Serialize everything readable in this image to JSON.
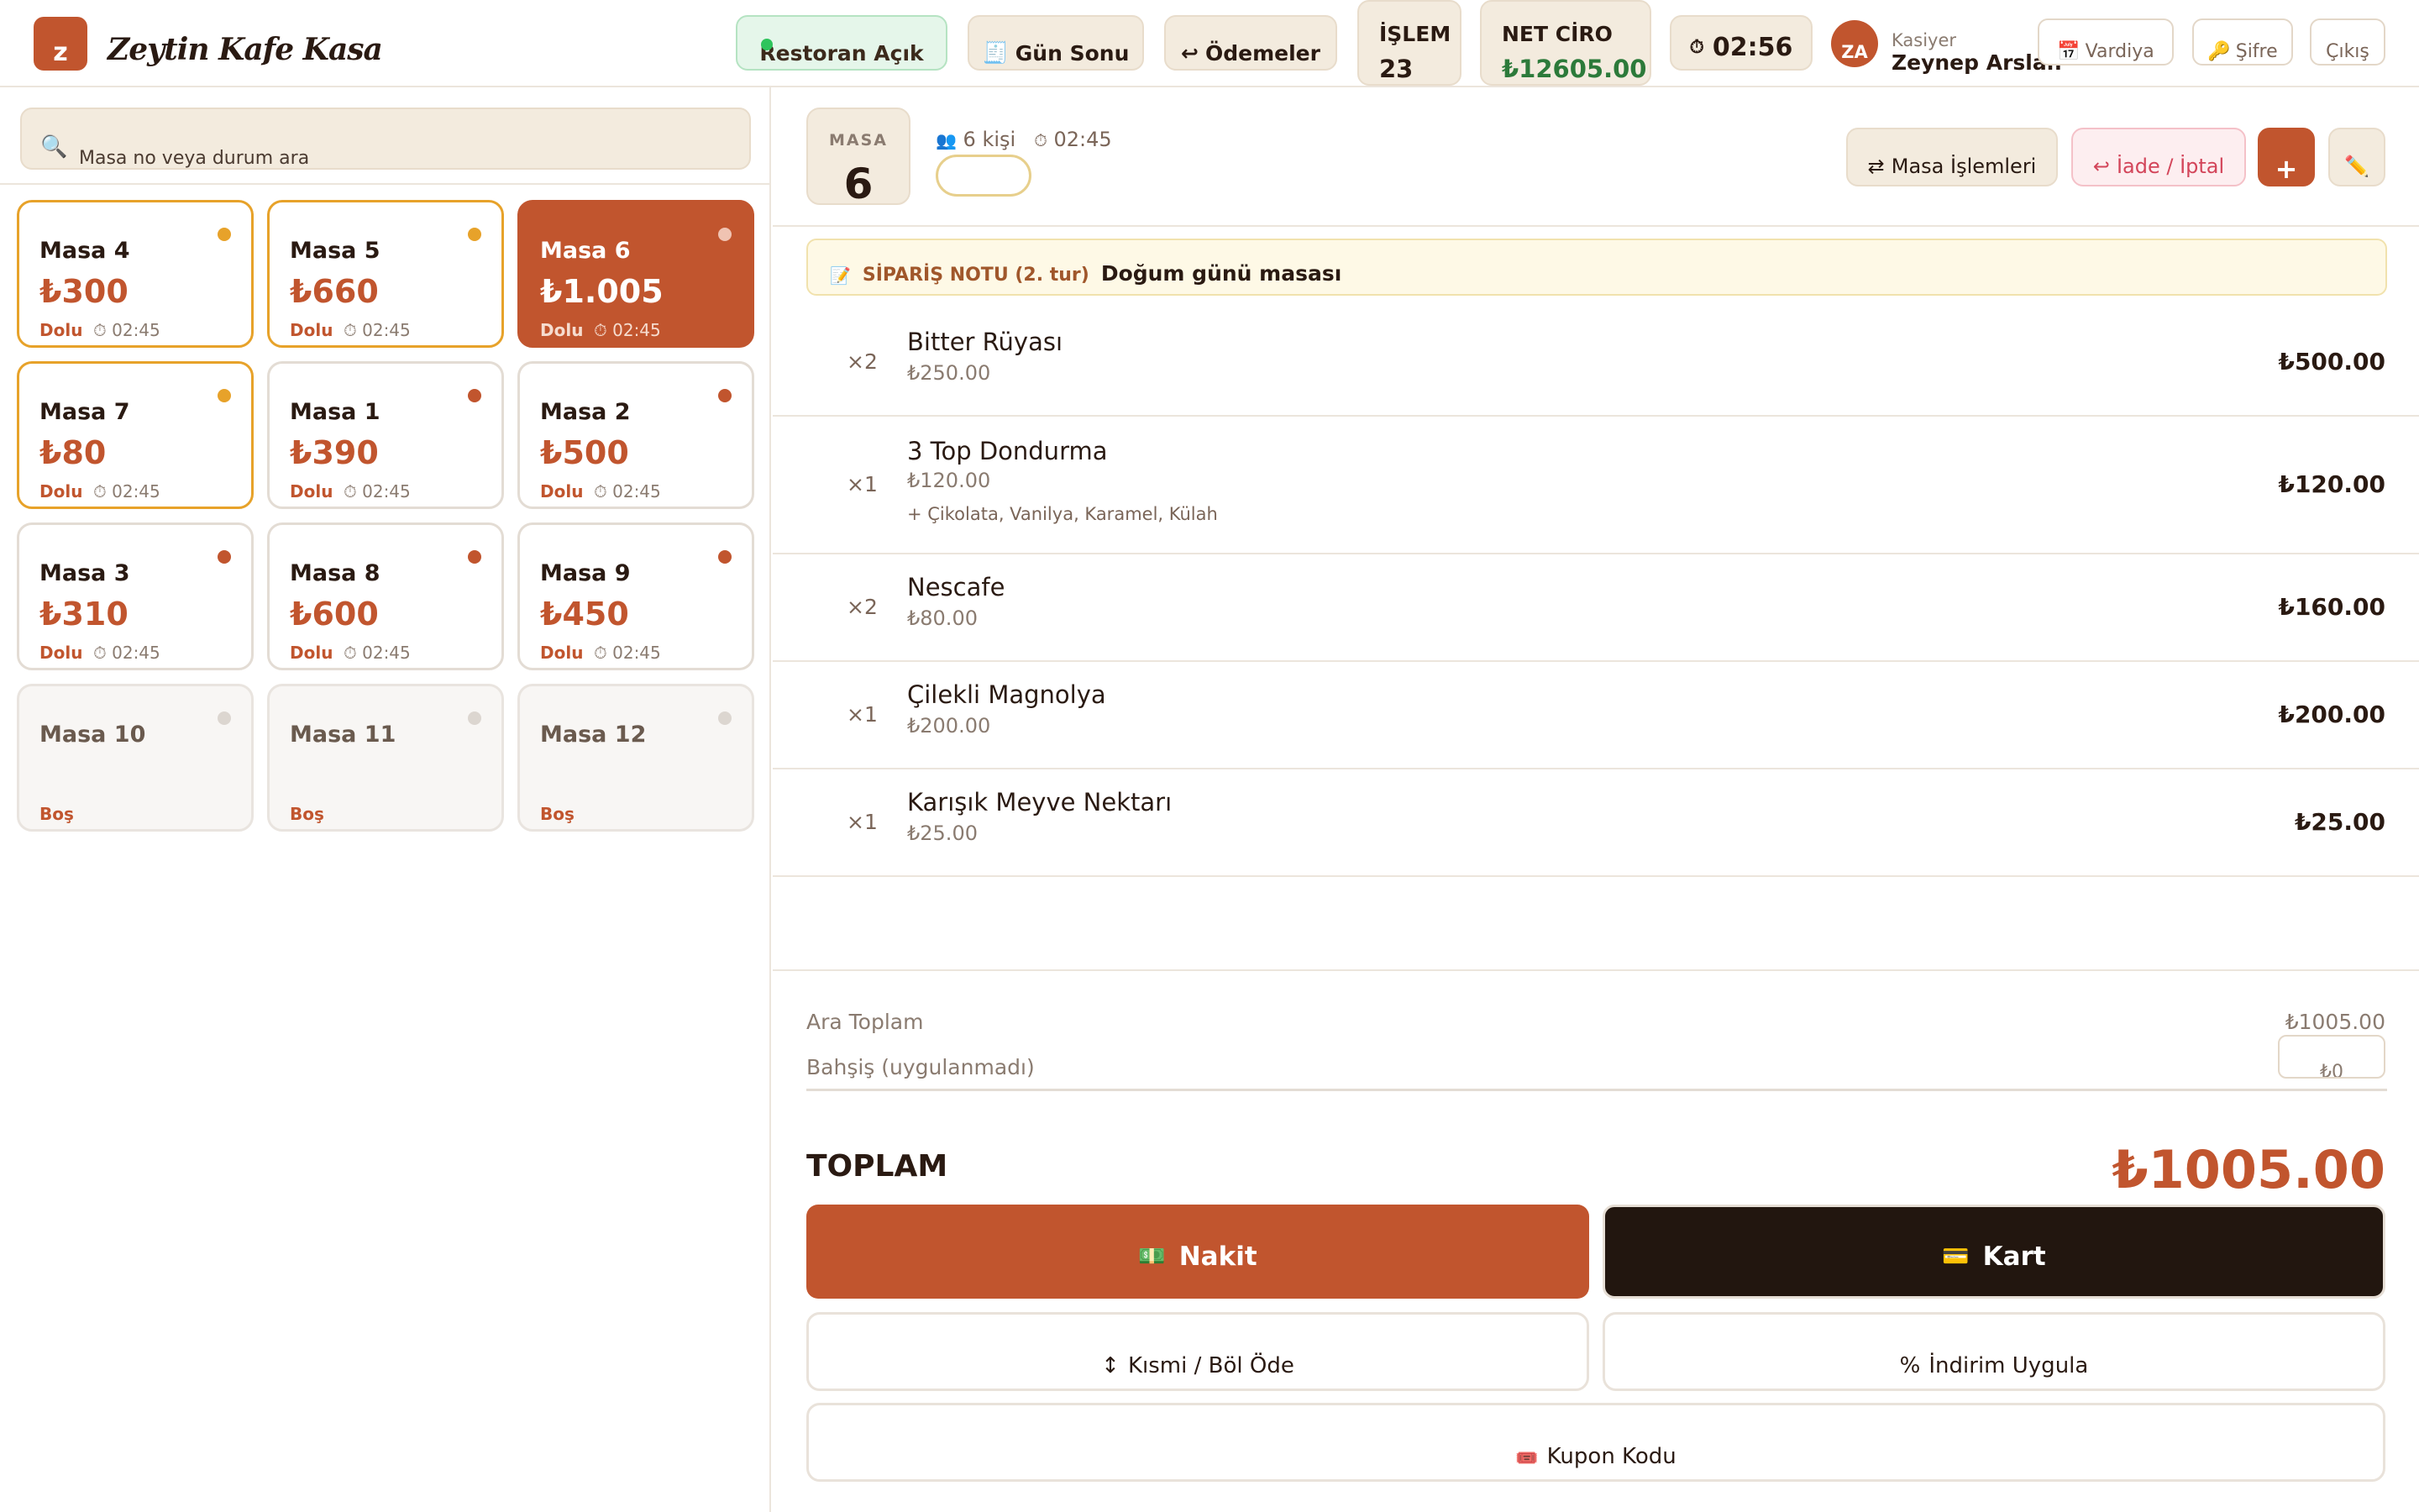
{
  "header": {
    "logo_letter": "z",
    "app_title": "Zeytin Kafe Kasa",
    "status_label": "Restoran Açık",
    "day_end_icon": "🧾",
    "day_end_label": "Gün Sonu",
    "payments_icon": "↩",
    "payments_label": "Ödemeler",
    "transactions_label": "İŞLEM",
    "transactions_value": "23",
    "net_revenue_label": "NET CİRO",
    "net_revenue_value": "₺12605.00",
    "clock_icon": "⏱",
    "clock": "02:56",
    "user_initials": "ZA",
    "user_role": "Kasiyer",
    "user_name": "Zeynep Arslan",
    "shift_icon": "📅",
    "shift_label": "Vardiya",
    "password_icon": "🔑",
    "password_label": "Şifre",
    "logout_label": "Çıkış"
  },
  "sidebar": {
    "search_icon": "🔍",
    "search_placeholder": "Masa no veya durum ara",
    "tables": [
      {
        "name": "Masa 4",
        "amount": "₺300",
        "status": "Dolu",
        "time": "⏱ 02:45",
        "state": "busy-o",
        "dot": "#e7a22a"
      },
      {
        "name": "Masa 5",
        "amount": "₺660",
        "status": "Dolu",
        "time": "⏱ 02:45",
        "state": "busy-o",
        "dot": "#e7a22a"
      },
      {
        "name": "Masa 6",
        "amount": "₺1.005",
        "status": "Dolu",
        "time": "⏱ 02:45",
        "state": "sel",
        "dot": "#f0c3b2"
      },
      {
        "name": "Masa 7",
        "amount": "₺80",
        "status": "Dolu",
        "time": "⏱ 02:45",
        "state": "busy-o",
        "dot": "#e7a22a"
      },
      {
        "name": "Masa 1",
        "amount": "₺390",
        "status": "Dolu",
        "time": "⏱ 02:45",
        "state": "busy-r",
        "dot": "#c1552e"
      },
      {
        "name": "Masa 2",
        "amount": "₺500",
        "status": "Dolu",
        "time": "⏱ 02:45",
        "state": "busy-r",
        "dot": "#c1552e"
      },
      {
        "name": "Masa 3",
        "amount": "₺310",
        "status": "Dolu",
        "time": "⏱ 02:45",
        "state": "busy-r",
        "dot": "#c1552e"
      },
      {
        "name": "Masa 8",
        "amount": "₺600",
        "status": "Dolu",
        "time": "⏱ 02:45",
        "state": "busy-r",
        "dot": "#c1552e"
      },
      {
        "name": "Masa 9",
        "amount": "₺450",
        "status": "Dolu",
        "time": "⏱ 02:45",
        "state": "busy-r",
        "dot": "#c1552e"
      },
      {
        "name": "Masa 10",
        "amount": "",
        "status": "Boş",
        "time": "",
        "state": "empty",
        "dot": "#dcd6d0"
      },
      {
        "name": "Masa 11",
        "amount": "",
        "status": "Boş",
        "time": "",
        "state": "empty",
        "dot": "#dcd6d0"
      },
      {
        "name": "Masa 12",
        "amount": "",
        "status": "Boş",
        "time": "",
        "state": "empty",
        "dot": "#dcd6d0"
      }
    ]
  },
  "order": {
    "table_label": "MASA",
    "table_number": "6",
    "guests_icon": "👥",
    "guests": "6 kişi",
    "time_icon": "⏱",
    "time": "02:45",
    "table_ops_icon": "⇄",
    "table_ops_label": "Masa İşlemleri",
    "refund_icon": "↩",
    "refund_label": "İade / İptal",
    "add_label": "+",
    "edit_icon": "✏️",
    "note_icon": "📝",
    "note_label": "SİPARİŞ NOTU (2. tur)",
    "note_text": "Doğum günü masası",
    "items": [
      {
        "qty": "×2",
        "name": "Bitter Rüyası",
        "unit": "₺250.00",
        "extras": "",
        "total": "₺500.00"
      },
      {
        "qty": "×1",
        "name": "3 Top Dondurma",
        "unit": "₺120.00",
        "extras": "+ Çikolata, Vanilya, Karamel, Külah",
        "total": "₺120.00"
      },
      {
        "qty": "×2",
        "name": "Nescafe",
        "unit": "₺80.00",
        "extras": "",
        "total": "₺160.00"
      },
      {
        "qty": "×1",
        "name": "Çilekli Magnolya",
        "unit": "₺200.00",
        "extras": "",
        "total": "₺200.00"
      },
      {
        "qty": "×1",
        "name": "Karışık Meyve Nektarı",
        "unit": "₺25.00",
        "extras": "",
        "total": "₺25.00"
      }
    ],
    "subtotal_label": "Ara Toplam",
    "subtotal_value": "₺1005.00",
    "tip_label": "Bahşiş (uygulanmadı)",
    "tip_value": "₺0",
    "total_label": "TOPLAM",
    "total_value": "₺1005.00",
    "cash_icon": "💵",
    "cash_label": "Nakit",
    "card_icon": "💳",
    "card_label": "Kart",
    "split_icon": "↕",
    "split_label": "Kısmi / Böl Öde",
    "discount_icon": "%",
    "discount_label": "İndirim Uygula",
    "coupon_icon": "🎟️",
    "coupon_label": "Kupon Kodu"
  }
}
